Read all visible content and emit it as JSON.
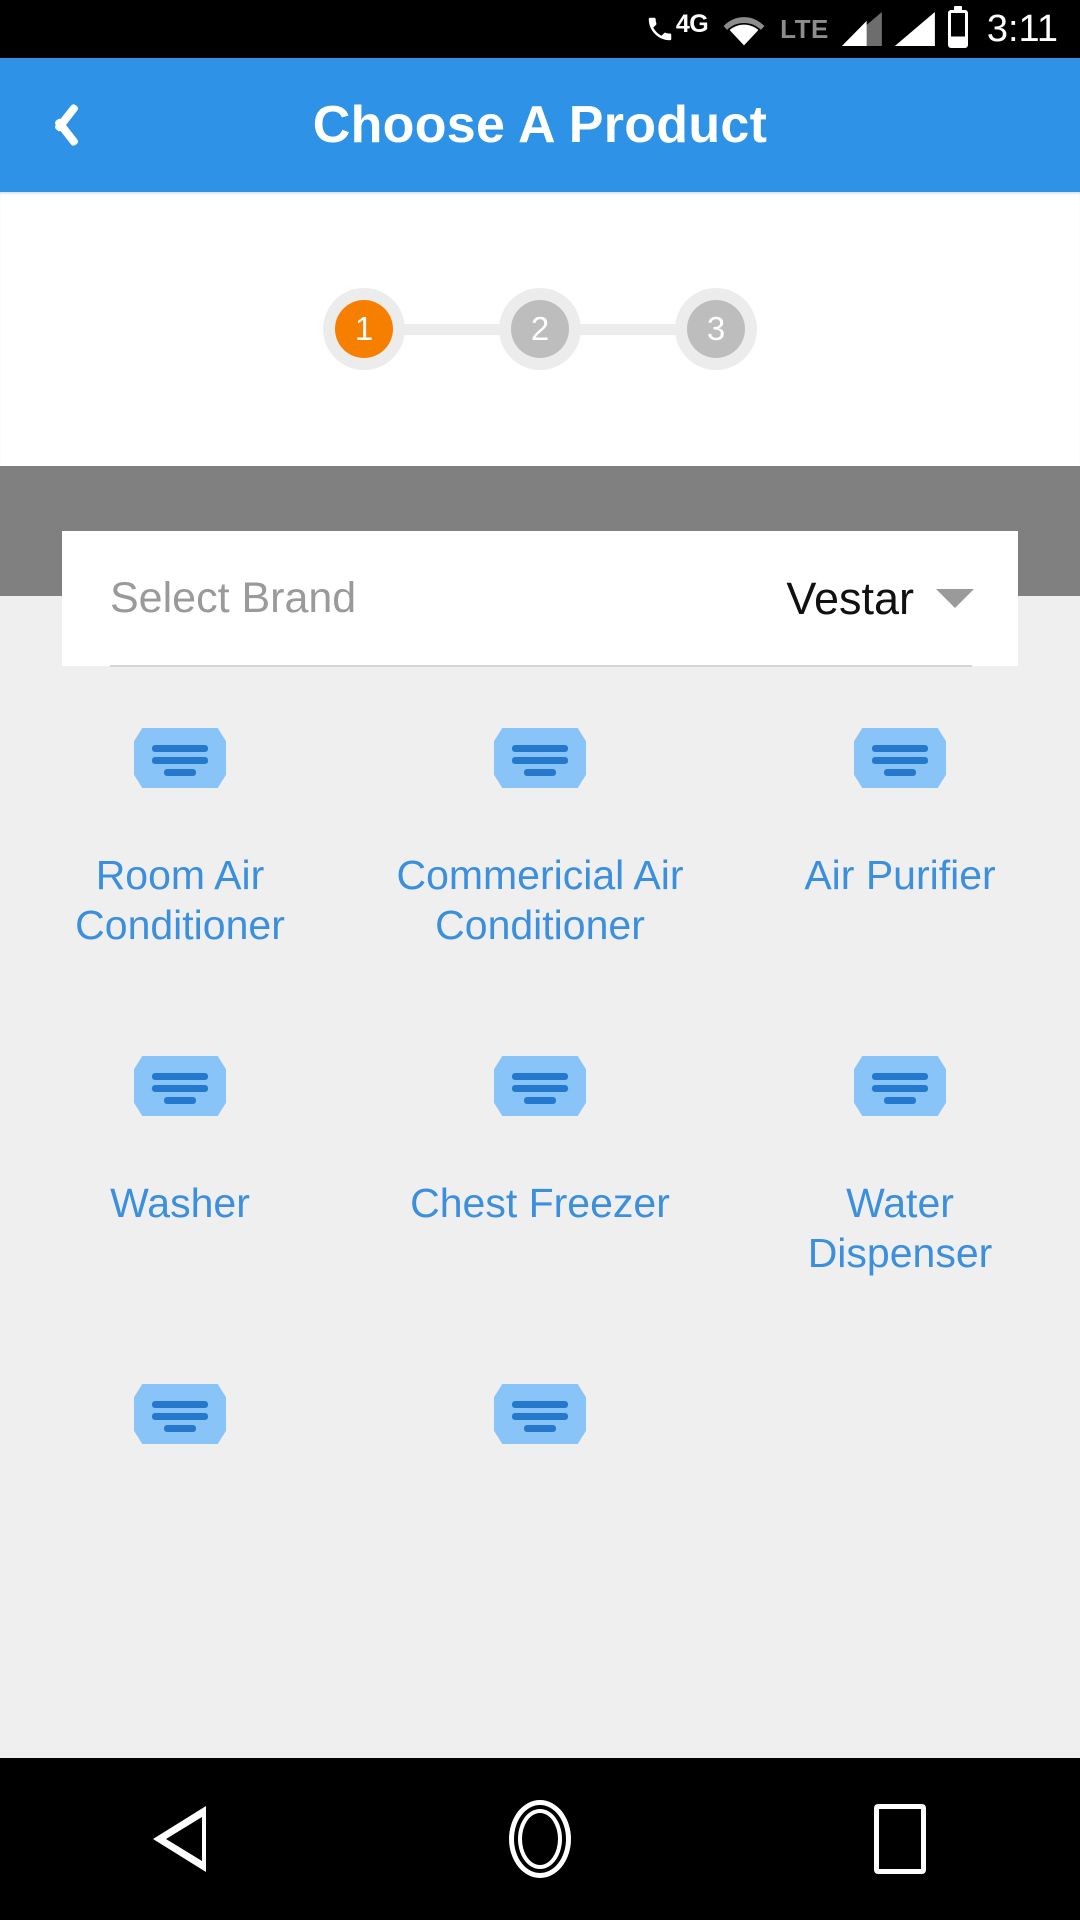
{
  "status_bar": {
    "network_4g": "4G",
    "network_lte": "LTE",
    "time": "3:11",
    "icons": [
      "phone-icon",
      "wifi-icon",
      "signal-bars-icon",
      "signal-bars-icon",
      "battery-icon"
    ]
  },
  "app_bar": {
    "title": "Choose A Product",
    "back_icon": "chevron-left-icon"
  },
  "stepper": {
    "steps": [
      {
        "number": "1",
        "state": "active"
      },
      {
        "number": "2",
        "state": "inactive"
      },
      {
        "number": "3",
        "state": "inactive"
      }
    ],
    "active_color": "#f77f00",
    "inactive_color": "#bdbdbd",
    "ring_color": "#ececec"
  },
  "brand_select": {
    "label": "Select Brand",
    "value": "Vestar",
    "caret_icon": "chevron-down-icon",
    "band_color": "#808080"
  },
  "products": [
    {
      "label": "Room Air Conditioner",
      "icon": "product-lines-icon"
    },
    {
      "label": "Commericial Air Conditioner",
      "icon": "product-lines-icon"
    },
    {
      "label": "Air Purifier",
      "icon": "product-lines-icon"
    },
    {
      "label": "Washer",
      "icon": "product-lines-icon"
    },
    {
      "label": "Chest Freezer",
      "icon": "product-lines-icon"
    },
    {
      "label": "Water Dispenser",
      "icon": "product-lines-icon"
    },
    {
      "label": "",
      "icon": "product-lines-icon"
    },
    {
      "label": "",
      "icon": "product-lines-icon"
    },
    {
      "label": "",
      "icon": ""
    }
  ],
  "nav_bar": {
    "back": "back-triangle-icon",
    "home": "home-circle-icon",
    "recents": "recents-square-icon"
  },
  "colors": {
    "primary": "#2e93e6",
    "accent_orange": "#f77f00",
    "product_label": "#3b8fdd",
    "background": "#efefef"
  }
}
